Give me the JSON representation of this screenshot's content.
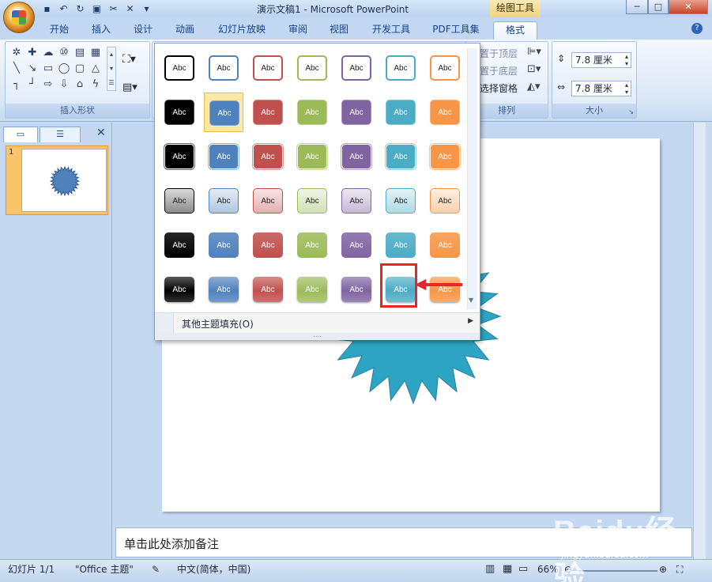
{
  "window": {
    "title": "演示文稿1 - Microsoft PowerPoint",
    "context_tab_title": "绘图工具"
  },
  "tabs": [
    {
      "label": "开始"
    },
    {
      "label": "插入"
    },
    {
      "label": "设计"
    },
    {
      "label": "动画"
    },
    {
      "label": "幻灯片放映"
    },
    {
      "label": "审阅"
    },
    {
      "label": "视图"
    },
    {
      "label": "开发工具"
    },
    {
      "label": "PDF工具集"
    },
    {
      "label": "格式"
    }
  ],
  "ribbon": {
    "insert_shapes_label": "插入形状",
    "arrange": {
      "bring_front": "置于顶层",
      "send_back": "置于底层",
      "selection_pane": "选择窗格",
      "label": "排列"
    },
    "size": {
      "height": "7.8 厘米",
      "width": "7.8 厘米",
      "label": "大小"
    }
  },
  "gallery": {
    "swatch_text": "Abc",
    "more_fills_label": "其他主题填充(O)",
    "colors": [
      "#000000",
      "#4f81bd",
      "#c0504d",
      "#9bbb59",
      "#8064a2",
      "#4bacc6",
      "#f79646"
    ],
    "selected": {
      "row": 2,
      "col": 2
    }
  },
  "notes_placeholder": "单击此处添加备注",
  "slides_pane": {
    "thumbnail_number": "1"
  },
  "status": {
    "slide_info": "幻灯片 1/1",
    "theme": "\"Office 主题\"",
    "language": "中文(简体，中国)",
    "zoom": "66%"
  },
  "watermark": {
    "brand": "Baidu经验",
    "url": "jingyan.baidu.com"
  }
}
